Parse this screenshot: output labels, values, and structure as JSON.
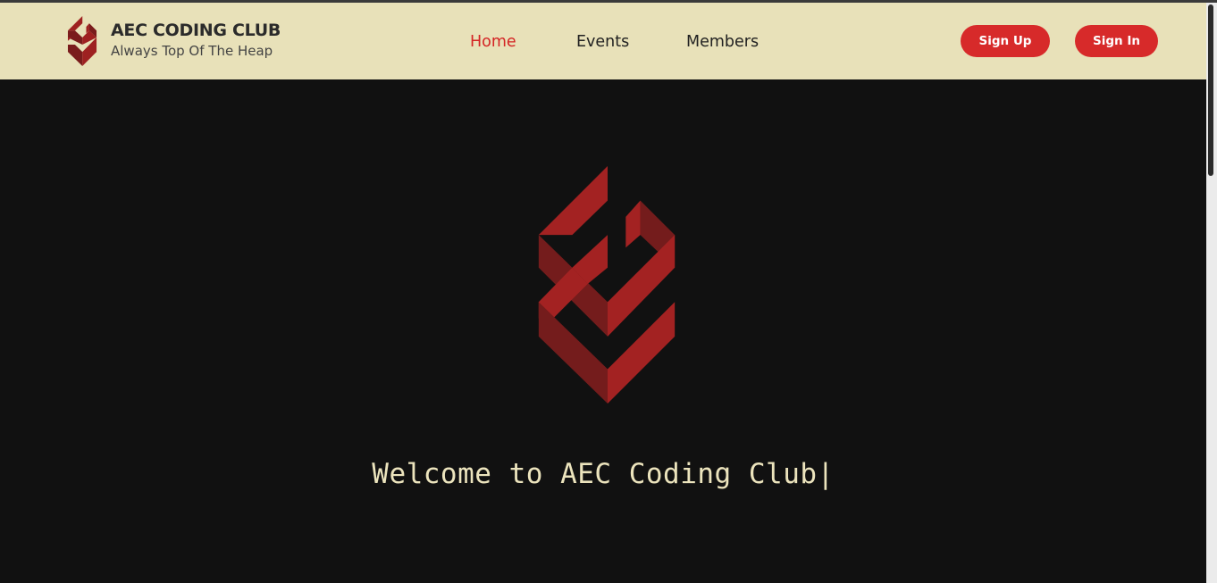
{
  "brand": {
    "title": "AEC CODING CLUB",
    "subtitle": "Always Top Of The Heap",
    "logo_icon": "aec-logo-icon"
  },
  "nav": {
    "items": [
      {
        "label": "Home",
        "active": true
      },
      {
        "label": "Events",
        "active": false
      },
      {
        "label": "Members",
        "active": false
      }
    ]
  },
  "auth": {
    "signup_label": "Sign Up",
    "signin_label": "Sign In"
  },
  "hero": {
    "welcome_text": "Welcome to AEC Coding Club",
    "cursor": "|",
    "logo_icon": "aec-logo-icon"
  },
  "colors": {
    "navbar_bg": "#e8e1b9",
    "page_bg": "#111111",
    "accent_red": "#d72a2a",
    "welcome_text": "#ece4bd"
  }
}
